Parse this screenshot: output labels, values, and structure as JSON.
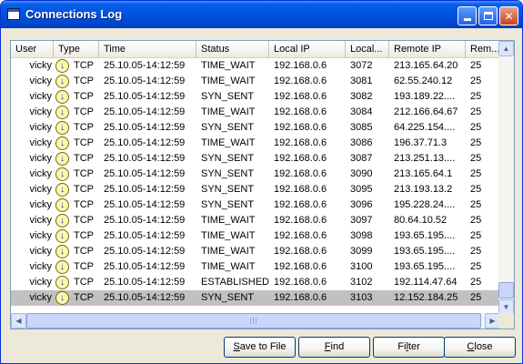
{
  "window": {
    "title": "Connections Log"
  },
  "columns": [
    "User",
    "Type",
    "Time",
    "Status",
    "Local IP",
    "Local...",
    "Remote IP",
    "Rem..."
  ],
  "rows": [
    {
      "user": "vicky",
      "icon": "info-arrow-icon",
      "type": "TCP",
      "time": "25.10.05-14:12:59",
      "status": "TIME_WAIT",
      "local_ip": "192.168.0.6",
      "local_port": "3072",
      "remote_ip": "213.165.64.20",
      "remote_port": "25"
    },
    {
      "user": "vicky",
      "icon": "info-arrow-icon",
      "type": "TCP",
      "time": "25.10.05-14:12:59",
      "status": "TIME_WAIT",
      "local_ip": "192.168.0.6",
      "local_port": "3081",
      "remote_ip": "62.55.240.12",
      "remote_port": "25"
    },
    {
      "user": "vicky",
      "icon": "info-arrow-icon",
      "type": "TCP",
      "time": "25.10.05-14:12:59",
      "status": "SYN_SENT",
      "local_ip": "192.168.0.6",
      "local_port": "3082",
      "remote_ip": "193.189.22....",
      "remote_port": "25"
    },
    {
      "user": "vicky",
      "icon": "info-arrow-icon",
      "type": "TCP",
      "time": "25.10.05-14:12:59",
      "status": "TIME_WAIT",
      "local_ip": "192.168.0.6",
      "local_port": "3084",
      "remote_ip": "212.166.64.67",
      "remote_port": "25"
    },
    {
      "user": "vicky",
      "icon": "info-arrow-icon",
      "type": "TCP",
      "time": "25.10.05-14:12:59",
      "status": "SYN_SENT",
      "local_ip": "192.168.0.6",
      "local_port": "3085",
      "remote_ip": "64.225.154....",
      "remote_port": "25"
    },
    {
      "user": "vicky",
      "icon": "info-arrow-icon",
      "type": "TCP",
      "time": "25.10.05-14:12:59",
      "status": "TIME_WAIT",
      "local_ip": "192.168.0.6",
      "local_port": "3086",
      "remote_ip": "196.37.71.3",
      "remote_port": "25"
    },
    {
      "user": "vicky",
      "icon": "info-arrow-icon",
      "type": "TCP",
      "time": "25.10.05-14:12:59",
      "status": "SYN_SENT",
      "local_ip": "192.168.0.6",
      "local_port": "3087",
      "remote_ip": "213.251.13....",
      "remote_port": "25"
    },
    {
      "user": "vicky",
      "icon": "info-arrow-icon",
      "type": "TCP",
      "time": "25.10.05-14:12:59",
      "status": "SYN_SENT",
      "local_ip": "192.168.0.6",
      "local_port": "3090",
      "remote_ip": "213.165.64.1",
      "remote_port": "25"
    },
    {
      "user": "vicky",
      "icon": "info-arrow-icon",
      "type": "TCP",
      "time": "25.10.05-14:12:59",
      "status": "SYN_SENT",
      "local_ip": "192.168.0.6",
      "local_port": "3095",
      "remote_ip": "213.193.13.2",
      "remote_port": "25"
    },
    {
      "user": "vicky",
      "icon": "info-arrow-icon",
      "type": "TCP",
      "time": "25.10.05-14:12:59",
      "status": "SYN_SENT",
      "local_ip": "192.168.0.6",
      "local_port": "3096",
      "remote_ip": "195.228.24....",
      "remote_port": "25"
    },
    {
      "user": "vicky",
      "icon": "info-arrow-icon",
      "type": "TCP",
      "time": "25.10.05-14:12:59",
      "status": "TIME_WAIT",
      "local_ip": "192.168.0.6",
      "local_port": "3097",
      "remote_ip": "80.64.10.52",
      "remote_port": "25"
    },
    {
      "user": "vicky",
      "icon": "info-arrow-icon",
      "type": "TCP",
      "time": "25.10.05-14:12:59",
      "status": "TIME_WAIT",
      "local_ip": "192.168.0.6",
      "local_port": "3098",
      "remote_ip": "193.65.195....",
      "remote_port": "25"
    },
    {
      "user": "vicky",
      "icon": "info-arrow-icon",
      "type": "TCP",
      "time": "25.10.05-14:12:59",
      "status": "TIME_WAIT",
      "local_ip": "192.168.0.6",
      "local_port": "3099",
      "remote_ip": "193.65.195....",
      "remote_port": "25"
    },
    {
      "user": "vicky",
      "icon": "info-arrow-icon",
      "type": "TCP",
      "time": "25.10.05-14:12:59",
      "status": "TIME_WAIT",
      "local_ip": "192.168.0.6",
      "local_port": "3100",
      "remote_ip": "193.65.195....",
      "remote_port": "25"
    },
    {
      "user": "vicky",
      "icon": "info-arrow-icon",
      "type": "TCP",
      "time": "25.10.05-14:12:59",
      "status": "ESTABLISHED",
      "local_ip": "192.168.0.6",
      "local_port": "3102",
      "remote_ip": "192.114.47.64",
      "remote_port": "25"
    },
    {
      "user": "vicky",
      "icon": "info-arrow-icon",
      "type": "TCP",
      "time": "25.10.05-14:12:59",
      "status": "SYN_SENT",
      "local_ip": "192.168.0.6",
      "local_port": "3103",
      "remote_ip": "12.152.184.25",
      "remote_port": "25",
      "selected": true
    }
  ],
  "buttons": {
    "save": {
      "pre": "",
      "key": "S",
      "post": "ave to File"
    },
    "find": {
      "pre": "",
      "key": "F",
      "post": "ind"
    },
    "filter": {
      "pre": "Fi",
      "key": "l",
      "post": "ter"
    },
    "close": {
      "pre": "",
      "key": "C",
      "post": "lose"
    }
  },
  "colors": {
    "title_bar": "#0054e3",
    "selected_row": "#c1c1c1",
    "window_bg": "#ece9d8"
  }
}
